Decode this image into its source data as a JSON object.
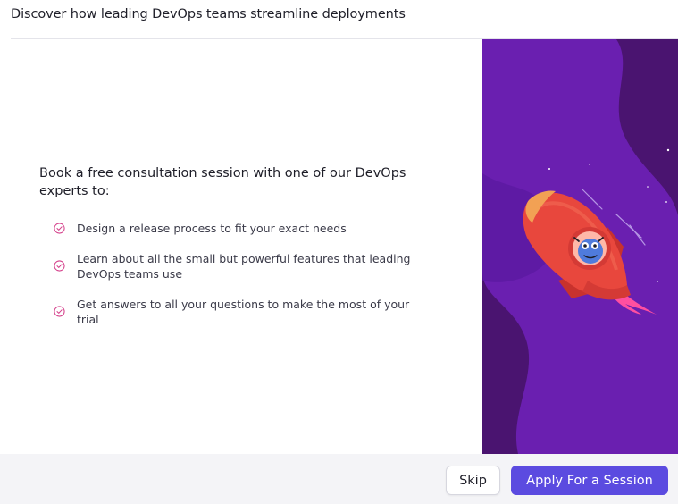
{
  "header": {
    "title": "Discover how leading DevOps teams streamline deployments"
  },
  "content": {
    "intro": "Book a free consultation session with one of our DevOps experts to:",
    "features": [
      {
        "text": "Design a release process to fit your exact needs"
      },
      {
        "text": "Learn about all the small but powerful features that leading DevOps teams use"
      },
      {
        "text": "Get answers to all your questions to make the most of your trial"
      }
    ]
  },
  "illustration": {
    "name": "rocket-illustration",
    "colors": {
      "background": "#4a1470",
      "blob": "#6a1fb0",
      "rocket": "#e8473d",
      "flame": "#ff4fa0",
      "mascot": "#4f7bdc"
    }
  },
  "footer": {
    "skip_label": "Skip",
    "apply_label": "Apply For a Session"
  },
  "colors": {
    "accent": "#5b4be0",
    "check": "#d43f8a"
  }
}
